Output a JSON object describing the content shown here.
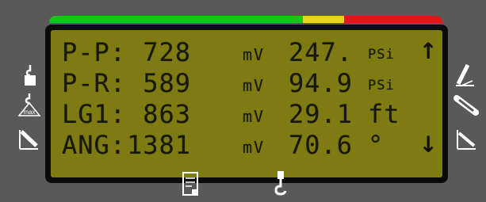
{
  "colors": {
    "background": "#595959",
    "lcd_background": "#7d7b12",
    "lcd_text": "#17170a",
    "status_green": "#19c419",
    "status_yellow": "#e8d41a",
    "status_red": "#e01818"
  },
  "status_bar": {
    "segments": [
      {
        "color": "green",
        "fraction": 0.645
      },
      {
        "color": "yellow",
        "fraction": 0.105
      },
      {
        "color": "red",
        "fraction": 0.25
      }
    ]
  },
  "display": {
    "rows": [
      {
        "label": "P-P:",
        "mv_value": "728",
        "mv_unit": "mV",
        "value": "247.",
        "unit": "PSi"
      },
      {
        "label": "P-R:",
        "mv_value": "589",
        "mv_unit": "mV",
        "value": "94.9",
        "unit": "PSi"
      },
      {
        "label": "LG1:",
        "mv_value": "863",
        "mv_unit": "mV",
        "value": "29.1",
        "unit": "ft"
      },
      {
        "label": "ANG:",
        "mv_value": "1381",
        "mv_unit": "mV",
        "value": "70.6",
        "unit": "°"
      }
    ],
    "scroll_up": "↑",
    "scroll_down": "↓"
  },
  "icons": {
    "left": [
      "hook-load-icon",
      "max-load-icon",
      "boom-angle-icon"
    ],
    "right": [
      "boom-raise-icon",
      "boom-extend-icon",
      "boom-lower-icon"
    ],
    "bottom": [
      "report-icon",
      "crane-hook-icon"
    ]
  }
}
